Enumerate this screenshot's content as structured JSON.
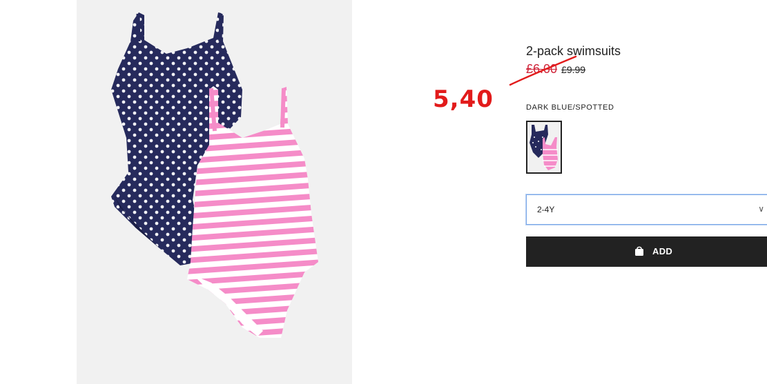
{
  "product": {
    "title": "2-pack swimsuits",
    "price_sale": "£6.00",
    "price_original": "£9.99",
    "image_icon": "product-photo-swimsuits"
  },
  "annotation": {
    "handwritten_price": "5,40",
    "color": "#e21b1b"
  },
  "colour": {
    "label": "DARK BLUE/SPOTTED",
    "selected_swatch_icon": "swimsuits-thumbnail"
  },
  "size_select": {
    "value": "2-4Y",
    "chevron_icon": "chevron-down-icon"
  },
  "add_button": {
    "label": "ADD",
    "icon": "shopping-bag-icon",
    "background": "#222222"
  },
  "colors": {
    "sale": "#d0253a",
    "navy": "#262a5c",
    "pink": "#f58cc8"
  }
}
